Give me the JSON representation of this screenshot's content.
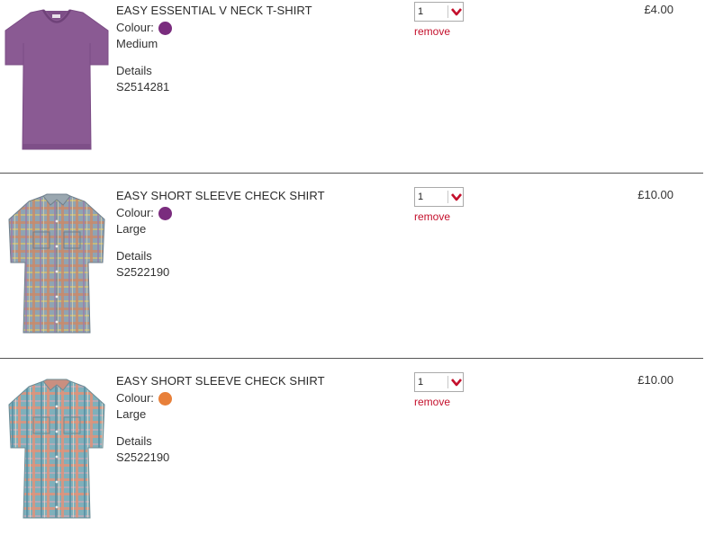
{
  "labels": {
    "colour": "Colour:",
    "details": "Details",
    "remove": "remove"
  },
  "colors": {
    "remove_link": "#c4102c",
    "purple_swatch": "#7a2c7e",
    "orange_swatch": "#e8803a",
    "divider": "#555555",
    "quantity_arrow": "#c4102c"
  },
  "items": [
    {
      "title": "EASY ESSENTIAL V NECK T-SHIRT",
      "colour_swatch": "#7a2c7e",
      "size": "Medium",
      "code": "S2514281",
      "quantity": "1",
      "price": "£4.00",
      "image": "purple-vneck-tshirt"
    },
    {
      "title": "EASY SHORT SLEEVE CHECK SHIRT",
      "colour_swatch": "#7a2c7e",
      "size": "Large",
      "code": "S2522190",
      "quantity": "1",
      "price": "£10.00",
      "image": "check-shirt-multicolour"
    },
    {
      "title": "EASY SHORT SLEEVE CHECK SHIRT",
      "colour_swatch": "#e8803a",
      "size": "Large",
      "code": "S2522190",
      "quantity": "1",
      "price": "£10.00",
      "image": "check-shirt-orange-blue"
    }
  ]
}
